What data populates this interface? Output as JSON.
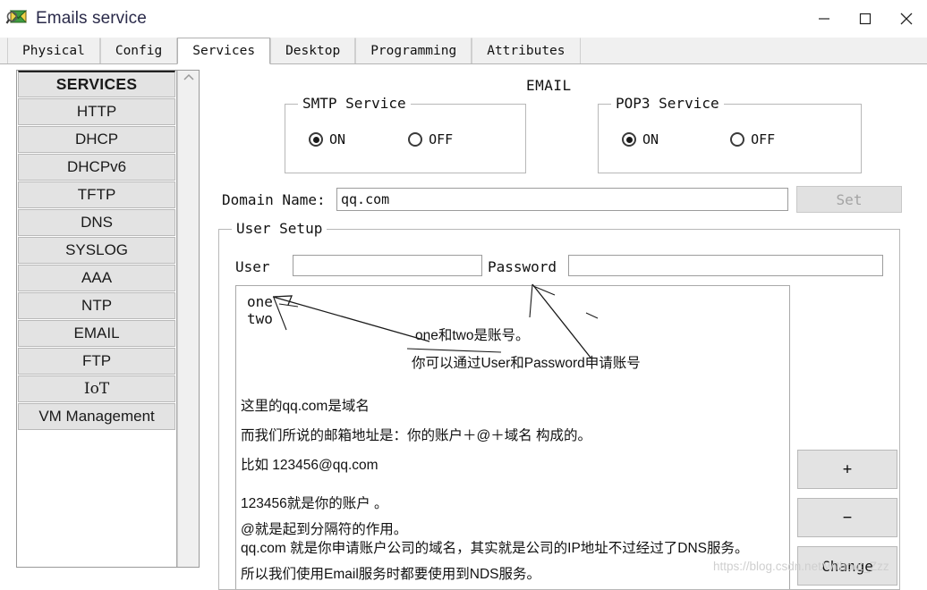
{
  "window": {
    "title": "Emails service",
    "icon": "email-magnifier-icon",
    "controls": {
      "minimize": "minimize-icon",
      "maximize": "maximize-icon",
      "close": "close-icon"
    }
  },
  "tabs": [
    {
      "label": "Physical",
      "active": false
    },
    {
      "label": "Config",
      "active": false
    },
    {
      "label": "Services",
      "active": true
    },
    {
      "label": "Desktop",
      "active": false
    },
    {
      "label": "Programming",
      "active": false
    },
    {
      "label": "Attributes",
      "active": false
    }
  ],
  "sidebar": {
    "header": "SERVICES",
    "scroll_arrow": "chevron-up-icon",
    "items": [
      {
        "label": "HTTP"
      },
      {
        "label": "DHCP"
      },
      {
        "label": "DHCPv6"
      },
      {
        "label": "TFTP"
      },
      {
        "label": "DNS"
      },
      {
        "label": "SYSLOG"
      },
      {
        "label": "AAA"
      },
      {
        "label": "NTP"
      },
      {
        "label": "EMAIL"
      },
      {
        "label": "FTP"
      },
      {
        "label": "IoT"
      },
      {
        "label": "VM Management"
      }
    ]
  },
  "main": {
    "page_title": "EMAIL",
    "smtp": {
      "legend": "SMTP Service",
      "on_label": "ON",
      "off_label": "OFF",
      "selected": "ON"
    },
    "pop3": {
      "legend": "POP3 Service",
      "on_label": "ON",
      "off_label": "OFF",
      "selected": "ON"
    },
    "domain": {
      "label": "Domain Name:",
      "value": "qq.com",
      "placeholder": "",
      "set_label": "Set",
      "set_enabled": false
    },
    "user_setup": {
      "legend": "User Setup",
      "user_label": "User",
      "user_value": "",
      "user_placeholder": "",
      "password_label": "Password",
      "password_value": "",
      "password_placeholder": "",
      "accounts": [
        "one",
        "two"
      ],
      "buttons": {
        "add": "+",
        "remove": "−",
        "change": "Change"
      }
    }
  },
  "annotations": {
    "note_accounts": "one和two是账号。",
    "note_apply": "你可以通过User和Password申请账号",
    "lines": [
      "这里的qq.com是域名",
      "而我们所说的邮箱地址是：你的账户＋@＋域名 构成的。",
      "比如 123456@qq.com",
      "123456就是你的账户 。",
      "@就是起到分隔符的作用。",
      "qq.com 就是你申请账户公司的域名，其实就是公司的IP地址不过经过了DNS服务。",
      "所以我们使用Email服务时都要使用到NDS服务。"
    ]
  },
  "watermark": "https://blog.csdn.net/without_Zzz",
  "colors": {
    "title_text": "#2a2a4a",
    "button_face": "#e3e3e3",
    "tab_active_bg": "#ffffff",
    "tab_bg": "#f0f0f0",
    "disabled_text": "#a3a3a3",
    "watermark": "#cfcfcf"
  }
}
